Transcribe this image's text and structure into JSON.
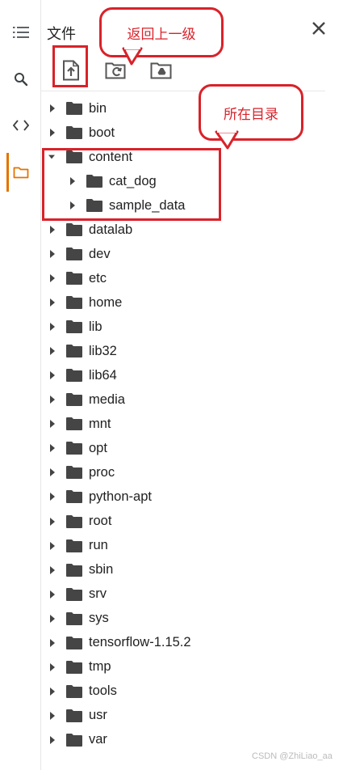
{
  "panel": {
    "title": "文件"
  },
  "sidebar": {
    "items": [
      {
        "name": "toc",
        "icon": "list-icon"
      },
      {
        "name": "search",
        "icon": "search-icon"
      },
      {
        "name": "code-snippets",
        "icon": "code-icon"
      },
      {
        "name": "files",
        "icon": "folder-icon",
        "active": true
      }
    ],
    "accent": "#e37400"
  },
  "toolbar": {
    "buttons": [
      {
        "name": "upload",
        "icon": "upload-file-icon"
      },
      {
        "name": "refresh",
        "icon": "refresh-folder-icon"
      },
      {
        "name": "mount-drive",
        "icon": "drive-folder-icon"
      }
    ]
  },
  "tree": {
    "items": [
      {
        "label": "bin",
        "expanded": false
      },
      {
        "label": "boot",
        "expanded": false
      },
      {
        "label": "content",
        "expanded": true
      },
      {
        "label": "cat_dog",
        "expanded": false
      },
      {
        "label": "sample_data",
        "expanded": false
      },
      {
        "label": "datalab",
        "expanded": false
      },
      {
        "label": "dev",
        "expanded": false
      },
      {
        "label": "etc",
        "expanded": false
      },
      {
        "label": "home",
        "expanded": false
      },
      {
        "label": "lib",
        "expanded": false
      },
      {
        "label": "lib32",
        "expanded": false
      },
      {
        "label": "lib64",
        "expanded": false
      },
      {
        "label": "media",
        "expanded": false
      },
      {
        "label": "mnt",
        "expanded": false
      },
      {
        "label": "opt",
        "expanded": false
      },
      {
        "label": "proc",
        "expanded": false
      },
      {
        "label": "python-apt",
        "expanded": false
      },
      {
        "label": "root",
        "expanded": false
      },
      {
        "label": "run",
        "expanded": false
      },
      {
        "label": "sbin",
        "expanded": false
      },
      {
        "label": "srv",
        "expanded": false
      },
      {
        "label": "sys",
        "expanded": false
      },
      {
        "label": "tensorflow-1.15.2",
        "expanded": false
      },
      {
        "label": "tmp",
        "expanded": false
      },
      {
        "label": "tools",
        "expanded": false
      },
      {
        "label": "usr",
        "expanded": false
      },
      {
        "label": "var",
        "expanded": false
      }
    ]
  },
  "annotations": {
    "go_up": "返回上一级",
    "current_dir": "所在目录",
    "color": "#d9222a"
  },
  "watermark": "CSDN @ZhiLiao_aa"
}
